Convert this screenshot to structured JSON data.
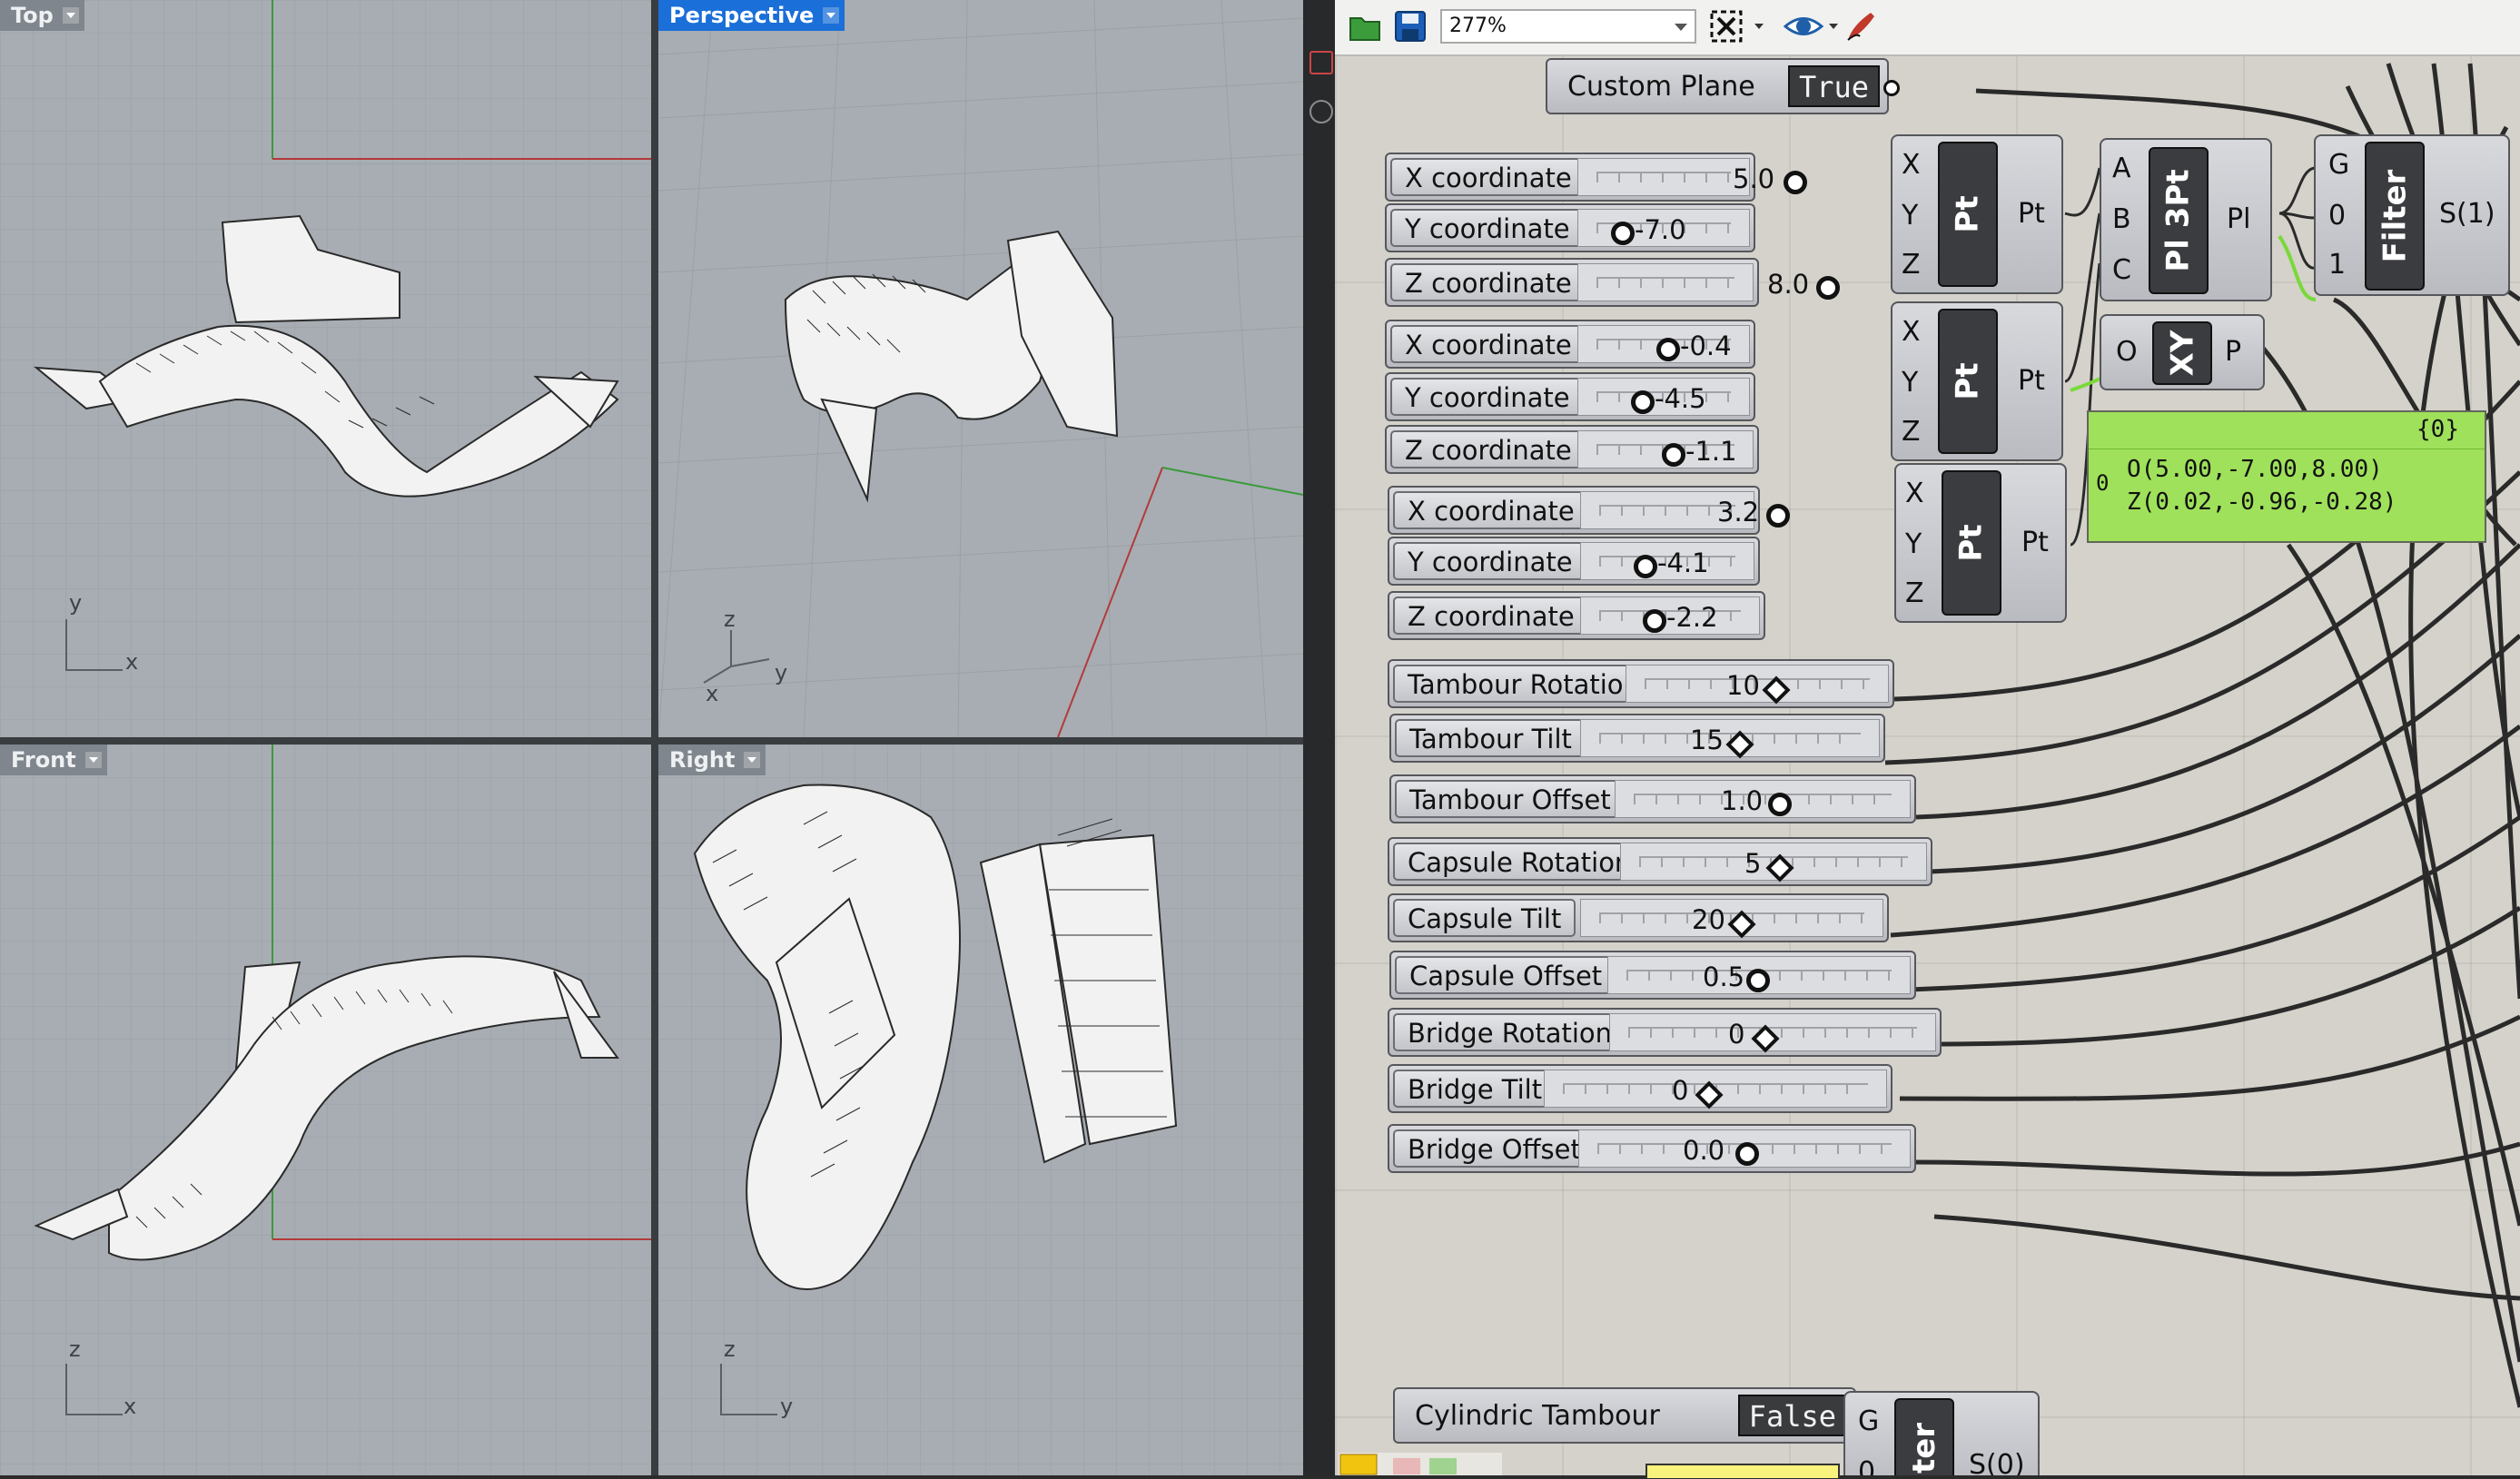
{
  "viewports": {
    "top": {
      "label": "Top",
      "axes": [
        "y",
        "x"
      ]
    },
    "perspective": {
      "label": "Perspective",
      "axes": [
        "z",
        "y",
        "x"
      ]
    },
    "front": {
      "label": "Front",
      "axes": [
        "z",
        "x"
      ]
    },
    "right": {
      "label": "Right",
      "axes": [
        "z",
        "y"
      ]
    }
  },
  "toolbar": {
    "zoom": "277%",
    "icons": [
      "open-file-icon",
      "save-icon",
      "zoom-extents-icon",
      "preview-eye-icon",
      "sketch-pen-icon"
    ]
  },
  "custom_plane": {
    "label": "Custom Plane",
    "value": "True"
  },
  "point_sliders": [
    {
      "label": "X coordinate",
      "value": "5.0"
    },
    {
      "label": "Y coordinate",
      "value": "-7.0"
    },
    {
      "label": "Z coordinate",
      "value": "8.0"
    },
    {
      "label": "X coordinate",
      "value": "-0.4"
    },
    {
      "label": "Y coordinate",
      "value": "-4.5"
    },
    {
      "label": "Z coordinate",
      "value": "-1.1"
    },
    {
      "label": "X coordinate",
      "value": "3.2"
    },
    {
      "label": "Y coordinate",
      "value": "-4.1"
    },
    {
      "label": "Z coordinate",
      "value": "-2.2"
    }
  ],
  "param_sliders": [
    {
      "label": "Tambour Rotation",
      "value": "10"
    },
    {
      "label": "Tambour Tilt",
      "value": "15"
    },
    {
      "label": "Tambour Offset",
      "value": "1.0"
    },
    {
      "label": "Capsule Rotation",
      "value": "5"
    },
    {
      "label": "Capsule Tilt",
      "value": "20"
    },
    {
      "label": "Capsule Offset",
      "value": "0.5"
    },
    {
      "label": "Bridge Rotation",
      "value": "0"
    },
    {
      "label": "Bridge Tilt",
      "value": "0"
    },
    {
      "label": "Bridge Offset",
      "value": "0.0"
    }
  ],
  "components": {
    "pt": {
      "inputs": [
        "X",
        "Y",
        "Z"
      ],
      "nickname": "Pt",
      "output": "Pt"
    },
    "pl3pt": {
      "inputs": [
        "A",
        "B",
        "C"
      ],
      "nickname": "Pl 3Pt",
      "output": "Pl"
    },
    "filter": {
      "inputs": [
        "G",
        "0",
        "1"
      ],
      "nickname": "Filter",
      "output": "S(1)"
    },
    "xy": {
      "input": "O",
      "nickname": "XY",
      "output": "P"
    },
    "filter2": {
      "inputs": [
        "G",
        "0"
      ],
      "nickname": "ter",
      "output": "S(0)"
    }
  },
  "panel": {
    "header": "{0}",
    "index": "0",
    "line1": "O(5.00,-7.00,8.00)",
    "line2": "Z(0.02,-0.96,-0.28)"
  },
  "cylindric_tambour": {
    "label": "Cylindric Tambour",
    "value": "False"
  },
  "colors": {
    "active_tab": "#1a6fd8",
    "viewport_bg": "#a7adb3",
    "canvas_bg": "#d4d2ca",
    "panel_green": "#9fe15a",
    "slider_bg": "#c7c9ce"
  }
}
